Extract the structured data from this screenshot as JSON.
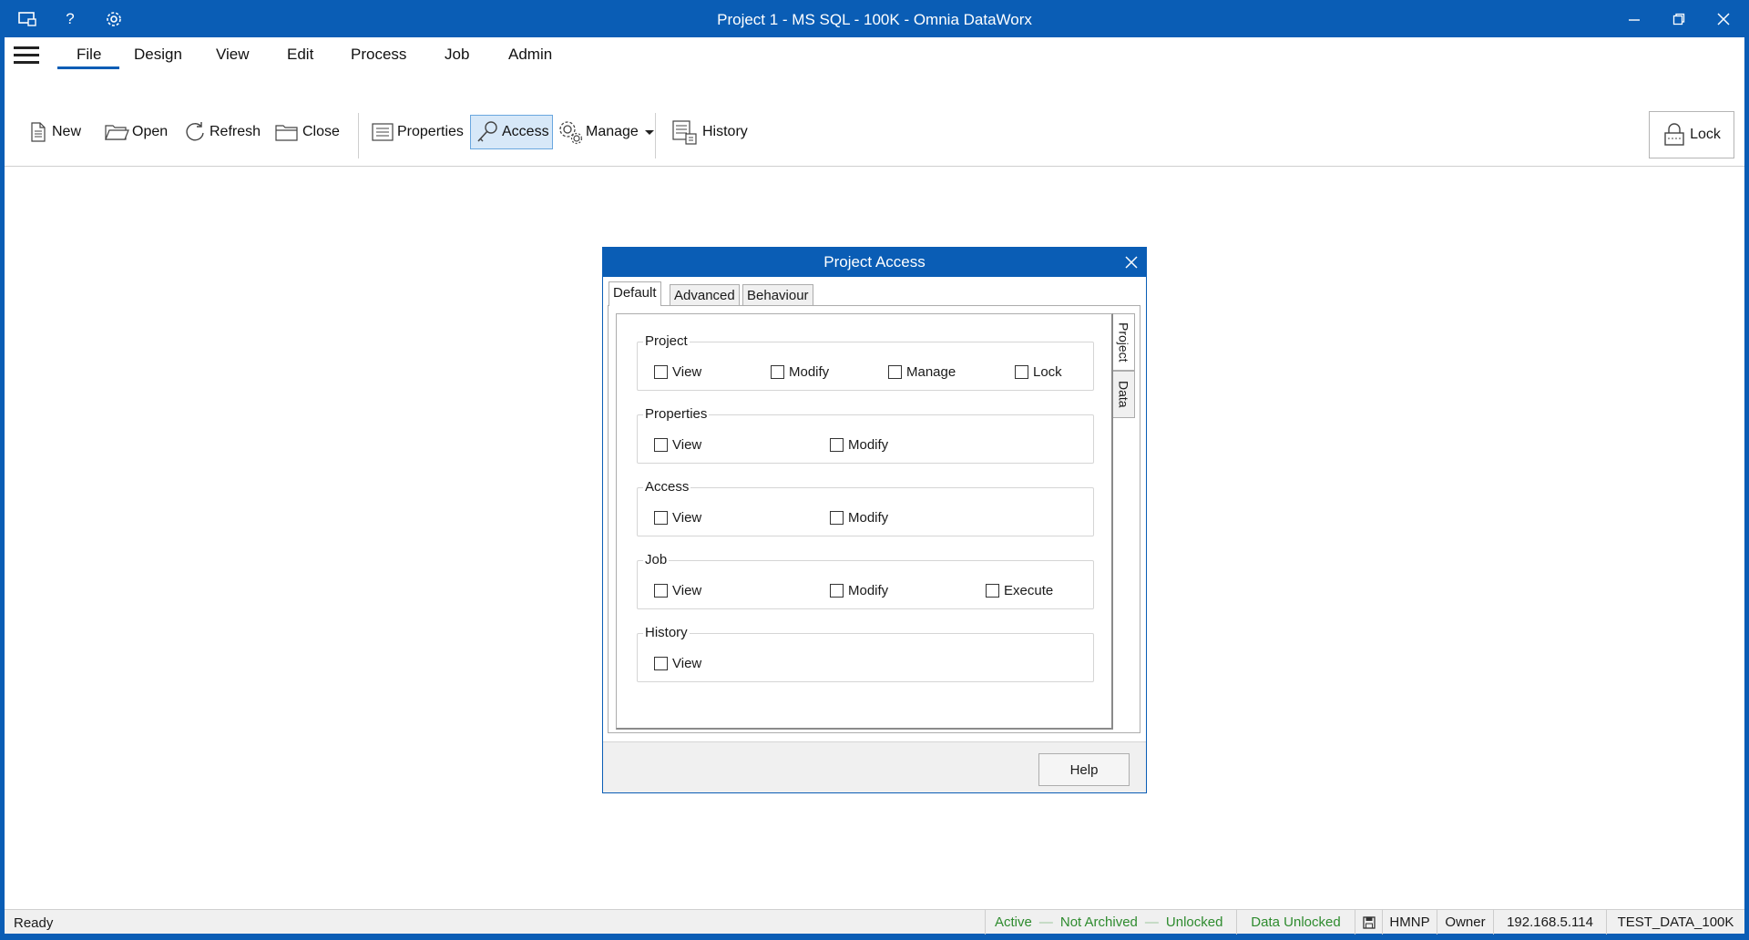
{
  "window": {
    "title": "Project 1 - MS SQL - 100K - Omnia DataWorx"
  },
  "menu": {
    "items": [
      "File",
      "Design",
      "View",
      "Edit",
      "Process",
      "Job",
      "Admin"
    ]
  },
  "ribbon": {
    "new": "New",
    "open": "Open",
    "refresh": "Refresh",
    "close": "Close",
    "properties": "Properties",
    "access": "Access",
    "manage": "Manage",
    "history": "History",
    "lock": "Lock"
  },
  "dialog": {
    "title": "Project Access",
    "tabs": [
      "Default",
      "Advanced",
      "Behaviour"
    ],
    "side_tabs": [
      "Project",
      "Data"
    ],
    "groups": [
      {
        "label": "Project",
        "options": [
          "View",
          "Modify",
          "Manage",
          "Lock"
        ]
      },
      {
        "label": "Properties",
        "options": [
          "View",
          "Modify"
        ]
      },
      {
        "label": "Access",
        "options": [
          "View",
          "Modify"
        ]
      },
      {
        "label": "Job",
        "options": [
          "View",
          "Modify",
          "Execute"
        ]
      },
      {
        "label": "History",
        "options": [
          "View"
        ]
      }
    ],
    "help": "Help"
  },
  "status": {
    "ready": "Ready",
    "active": "Active",
    "archived": "Not Archived",
    "unlocked": "Unlocked",
    "data_unlocked": "Data Unlocked",
    "user": "HMNP",
    "role": "Owner",
    "ip": "192.168.5.114",
    "database": "TEST_DATA_100K"
  },
  "colors": {
    "accent": "#0a5db5",
    "status_green": "#2e8b2e"
  }
}
